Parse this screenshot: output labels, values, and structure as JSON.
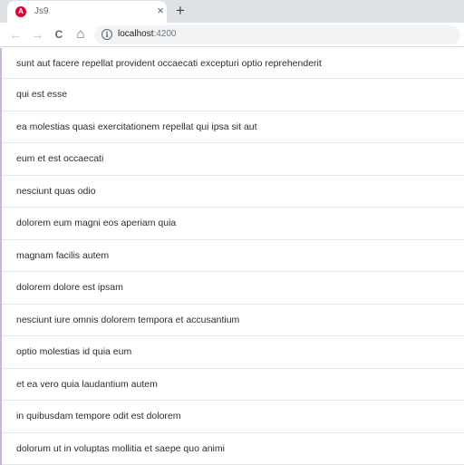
{
  "browser": {
    "tab": {
      "favicon_letter": "A",
      "title": "Js9",
      "close_glyph": "×"
    },
    "new_tab_glyph": "+",
    "nav": {
      "back_glyph": "←",
      "forward_glyph": "→",
      "reload_glyph": "C",
      "home_glyph": "⌂"
    },
    "address": {
      "info_glyph": "i",
      "host": "localhost",
      "port": ":4200"
    },
    "colors": {
      "favicon": "#dd0031",
      "tabstrip": "#dee1e6",
      "omnibox": "#f1f3f4"
    }
  },
  "posts": [
    "sunt aut facere repellat provident occaecati excepturi optio reprehenderit",
    "qui est esse",
    "ea molestias quasi exercitationem repellat qui ipsa sit aut",
    "eum et est occaecati",
    "nesciunt quas odio",
    "dolorem eum magni eos aperiam quia",
    "magnam facilis autem",
    "dolorem dolore est ipsam",
    "nesciunt iure omnis dolorem tempora et accusantium",
    "optio molestias id quia eum",
    "et ea vero quia laudantium autem",
    "in quibusdam tempore odit est dolorem",
    "dolorum ut in voluptas mollitia et saepe quo animi"
  ]
}
